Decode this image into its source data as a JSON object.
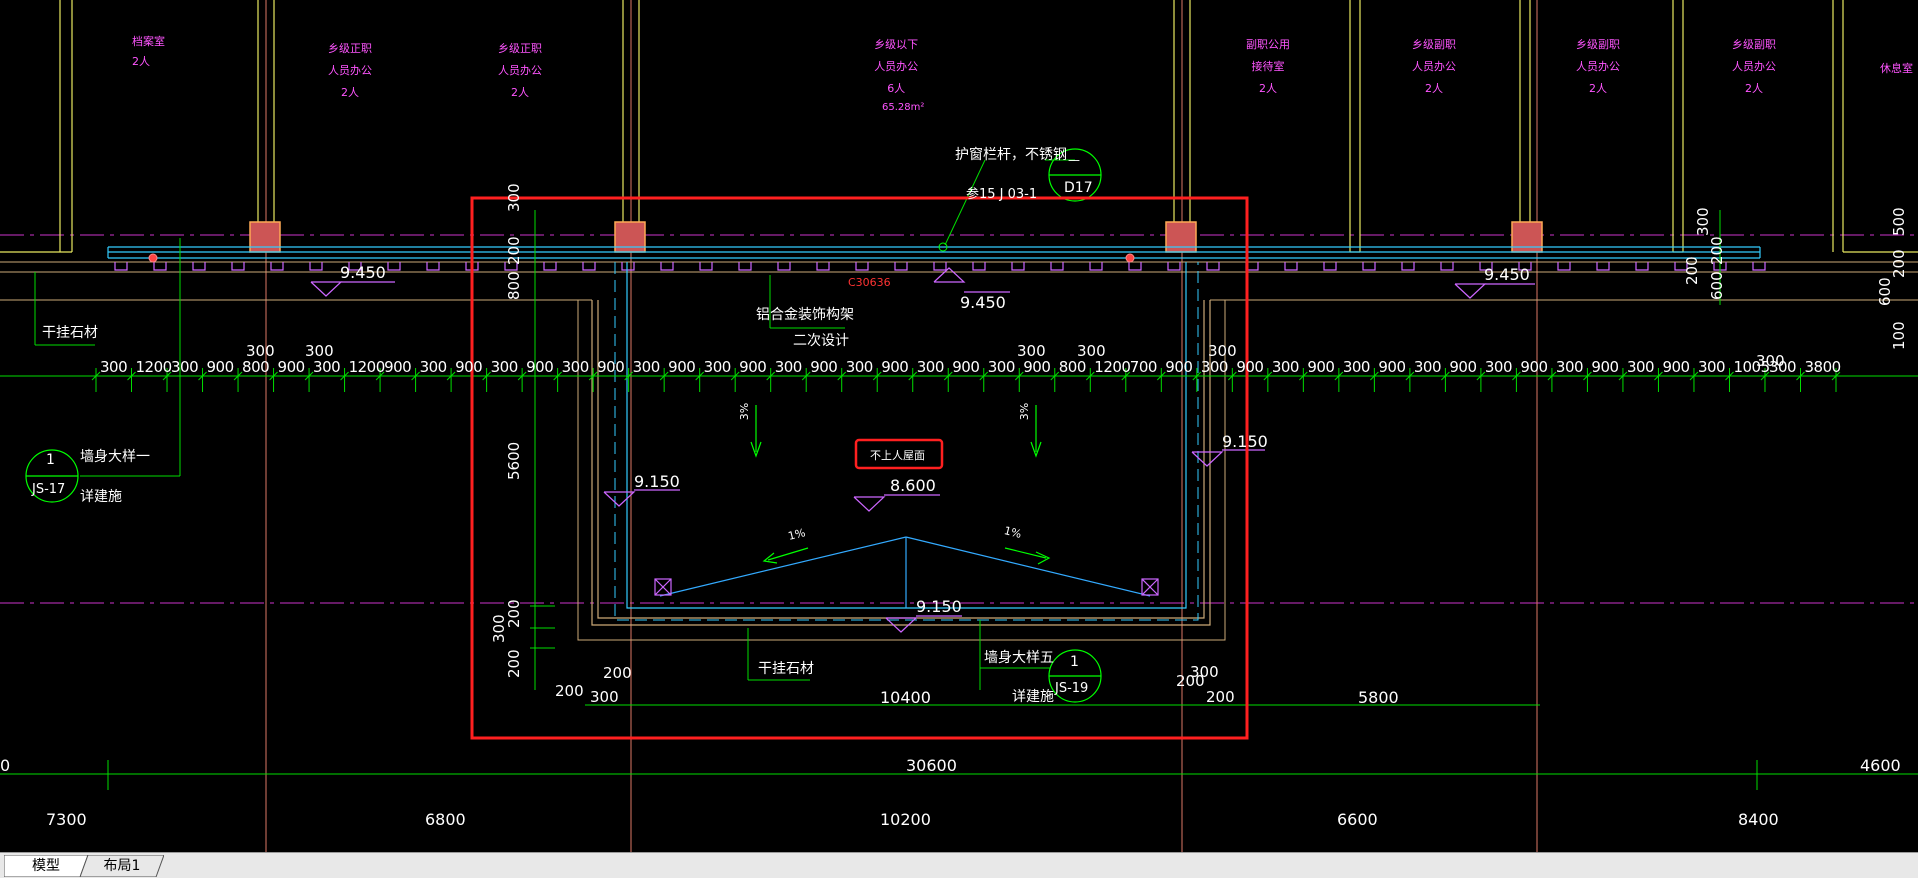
{
  "colors": {
    "background": "#000000",
    "magenta_text": "#ff55ff",
    "green_dim": "#00ff00",
    "cyan_line": "#33ccff",
    "yellow_wall": "#ffff66",
    "white_text": "#ffffff",
    "red_highlight": "#ff2020",
    "violet_symbol": "#cc66ff",
    "tan_line": "#ccaa77",
    "tab_bar_bg": "#e8e8e8"
  },
  "rooms": [
    {
      "name": "档案室",
      "occupancy": "2人",
      "extra": ""
    },
    {
      "name": "乡级正职",
      "sub": "人员办公",
      "occupancy": "2人"
    },
    {
      "name": "乡级正职",
      "sub": "人员办公",
      "occupancy": "2人"
    },
    {
      "name": "乡级以下",
      "sub": "人员办公",
      "occupancy": "6人",
      "area": "65.28m²"
    },
    {
      "name": "副职公用",
      "sub": "接待室",
      "occupancy": "2人"
    },
    {
      "name": "乡级副职",
      "sub": "人员办公",
      "occupancy": "2人"
    },
    {
      "name": "乡级副职",
      "sub": "人员办公",
      "occupancy": "2人"
    },
    {
      "name": "乡级副职",
      "sub": "人员办公",
      "occupancy": "2人"
    },
    {
      "name": "休息室",
      "sub": "",
      "occupancy": ""
    }
  ],
  "annotations": {
    "window_guard": "护窗栏杆，不锈钢",
    "ref_code": "参15 J 03-1",
    "callout_top": "—",
    "callout_bottom": "D17",
    "beam_code": "C30636",
    "aluminum_frame": "铝合金装饰构架",
    "secondary_design": "二次设计",
    "dry_stone_left": "干挂石材",
    "dry_stone_bottom": "干挂石材",
    "wall_detail_1": "墙身大样一",
    "detail_left": "详建施",
    "callout_1_num": "1",
    "callout_1_ref": "JS-17",
    "wall_detail_5": "墙身大样五",
    "detail_right": "详建施",
    "callout_5_num": "1",
    "callout_5_ref": "JS-19",
    "roof_label": "不上人屋面",
    "slope_3a": "3%",
    "slope_3b": "3%",
    "slope_1a": "1%",
    "slope_1b": "1%"
  },
  "elevations": {
    "e_9450_left": "9.450",
    "e_9450_mid": "9.450",
    "e_9450_right": "9.450",
    "e_9150_left": "9.150",
    "e_9150_right": "9.150",
    "e_8600": "8.600",
    "e_9150_bottom": "9.150"
  },
  "dimensions": {
    "row1": [
      "300",
      "1200",
      "300",
      "900",
      "800",
      "900",
      "300",
      "1200",
      "900",
      "300",
      "900",
      "300",
      "900",
      "300",
      "900",
      "300",
      "900",
      "300",
      "900",
      "300",
      "900",
      "300",
      "900",
      "300",
      "900",
      "300",
      "900",
      "800",
      "1200",
      "700",
      "900",
      "300",
      "900",
      "300",
      "900",
      "300",
      "900",
      "300",
      "900",
      "300",
      "900",
      "300",
      "900",
      "300",
      "900",
      "300",
      "1005",
      "300",
      "3800"
    ],
    "row1_upper": [
      "300",
      "300",
      "300",
      "300",
      "300",
      "300"
    ],
    "vertical_left": [
      "300",
      "200",
      "800",
      "5600",
      "200",
      "300",
      "200"
    ],
    "vertical_right": [
      "300",
      "200",
      "600",
      "200",
      "500",
      "200",
      "600",
      "100"
    ],
    "bottom_small": [
      "200",
      "300",
      "200",
      "200",
      "300",
      "200"
    ],
    "span_10400": "10400",
    "span_5800": "5800",
    "total_30600": "30600",
    "left_edge_0": "0",
    "right_4600": "4600",
    "grid_bays": [
      "7300",
      "6800",
      "10200",
      "6600",
      "8400"
    ]
  },
  "tabs": [
    {
      "label": "模型",
      "active": true
    },
    {
      "label": "布局1",
      "active": false
    }
  ]
}
